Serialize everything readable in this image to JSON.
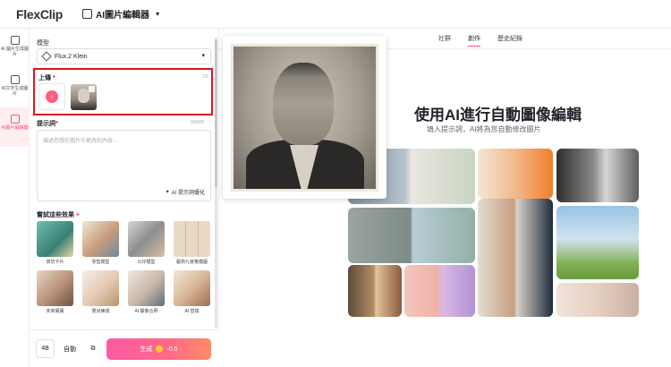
{
  "app": {
    "logo": "FlexClip",
    "editor_name": "AI圖片編輯器"
  },
  "rail": [
    {
      "label": "AI 圖片生成圖片"
    },
    {
      "label": "AI文字生成圖片"
    },
    {
      "label": "AI圖片編輯器"
    }
  ],
  "panel": {
    "model_label": "模型",
    "model_value": "Flux.2 Klein",
    "upload_label": "上傳",
    "upload_required": "*",
    "upload_count": "1/5",
    "prompt_label": "提示詞",
    "prompt_required": "*",
    "prompt_count": "0/5000",
    "prompt_placeholder": "描述您想在圖片中更改的內容...",
    "ai_optimize": "AI 提示詞優化",
    "effects_label": "嘗試這些效果",
    "effects": [
      {
        "label": "高仿卡片"
      },
      {
        "label": "零售模型"
      },
      {
        "label": "公仔模型"
      },
      {
        "label": "藝術九宮格模圖"
      },
      {
        "label": "未來寶寶"
      },
      {
        "label": "嬰兒練成"
      },
      {
        "label": "AI 靜像合照"
      },
      {
        "label": "AI 替換"
      }
    ],
    "ratio_chip": "4B",
    "auto_chip": "自動",
    "generate": {
      "label": "生成",
      "cost": "-0.5"
    }
  },
  "tabs": [
    "社群",
    "創作",
    "歷史紀錄"
  ],
  "tabs_active": "創作",
  "hero": {
    "title": "使用AI進行自動圖像編輯",
    "subtitle": "填入提示詞，AI將為您自動修改圖片"
  },
  "colors": {
    "accent": "#ff4d7a",
    "highlight_border": "#e0161b"
  }
}
